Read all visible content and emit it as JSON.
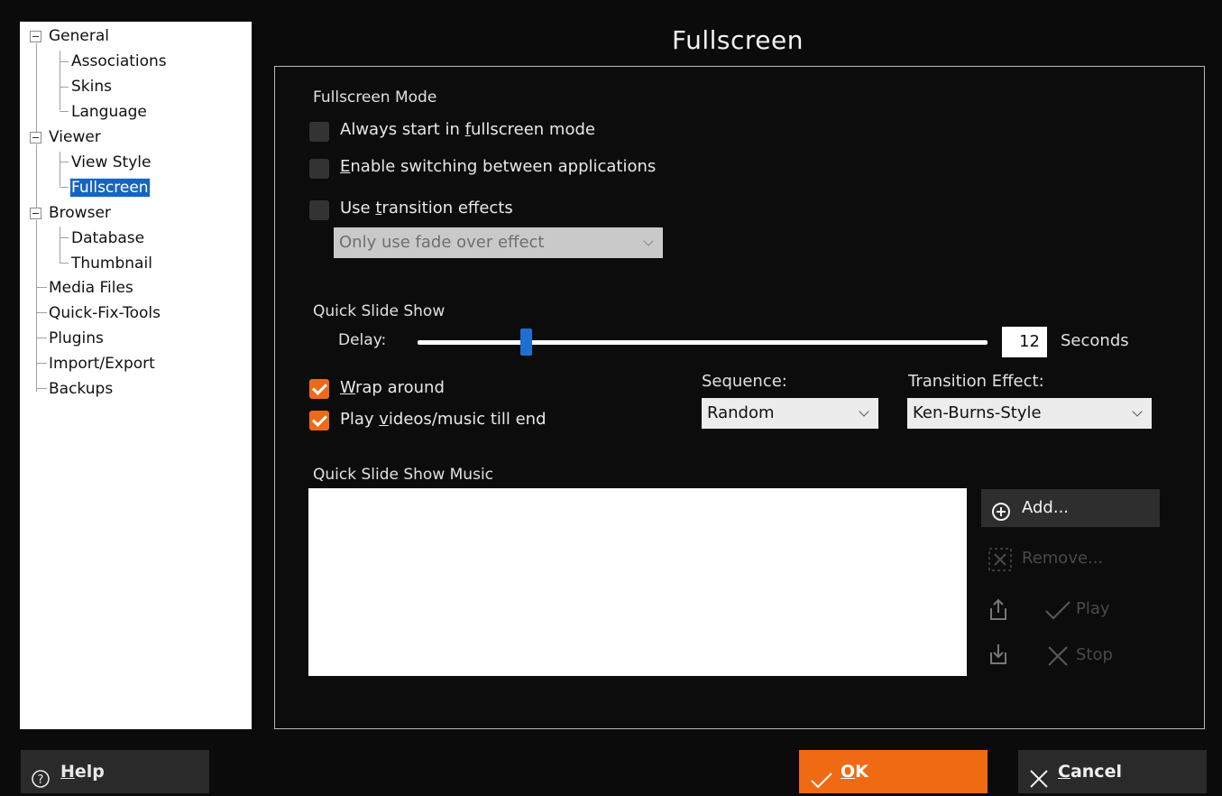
{
  "tree": {
    "items": [
      {
        "label": "General"
      },
      {
        "label": "Associations"
      },
      {
        "label": "Skins"
      },
      {
        "label": "Language"
      },
      {
        "label": "Viewer"
      },
      {
        "label": "View Style"
      },
      {
        "label": "Fullscreen"
      },
      {
        "label": "Browser"
      },
      {
        "label": "Database"
      },
      {
        "label": "Thumbnail"
      },
      {
        "label": "Media Files"
      },
      {
        "label": "Quick-Fix-Tools"
      },
      {
        "label": "Plugins"
      },
      {
        "label": "Import/Export"
      },
      {
        "label": "Backups"
      }
    ],
    "selected": "Fullscreen"
  },
  "page": {
    "title": "Fullscreen"
  },
  "fullscreen_mode": {
    "heading": "Fullscreen Mode",
    "always_start": {
      "pre": "Always start in ",
      "u": "f",
      "post": "ullscreen mode",
      "checked": false
    },
    "enable_switching": {
      "pre": "",
      "u": "E",
      "post": "nable switching between applications",
      "checked": false
    },
    "use_transition": {
      "pre": "Use ",
      "u": "t",
      "post": "ransition effects",
      "checked": false
    },
    "transition_select": "Only use fade over effect"
  },
  "slideshow": {
    "heading": "Quick Slide Show",
    "delay_label": "Delay:",
    "delay_value": "12",
    "seconds_label": "Seconds",
    "delay_fraction": 0.19,
    "wrap": {
      "pre": "",
      "u": "W",
      "post": "rap around",
      "checked": true
    },
    "play_till_end": {
      "pre": "Play ",
      "u": "v",
      "post": "ideos/music till end",
      "checked": true
    },
    "sequence_label": "Sequence:",
    "sequence_value": "Random",
    "transition_label": "Transition Effect:",
    "transition_value": "Ken-Burns-Style"
  },
  "music": {
    "heading": "Quick Slide Show Music",
    "add_label": "Add...",
    "remove_label": "Remove...",
    "play_label": "Play",
    "stop_label": "Stop"
  },
  "footer": {
    "help": {
      "u": "H",
      "post": "elp"
    },
    "ok": {
      "u": "O",
      "post": "K"
    },
    "cancel": {
      "u": "C",
      "post": "ancel"
    }
  },
  "colors": {
    "accent": "#f06a14",
    "selection": "#1565c0",
    "slider_thumb": "#1f6fd1"
  }
}
